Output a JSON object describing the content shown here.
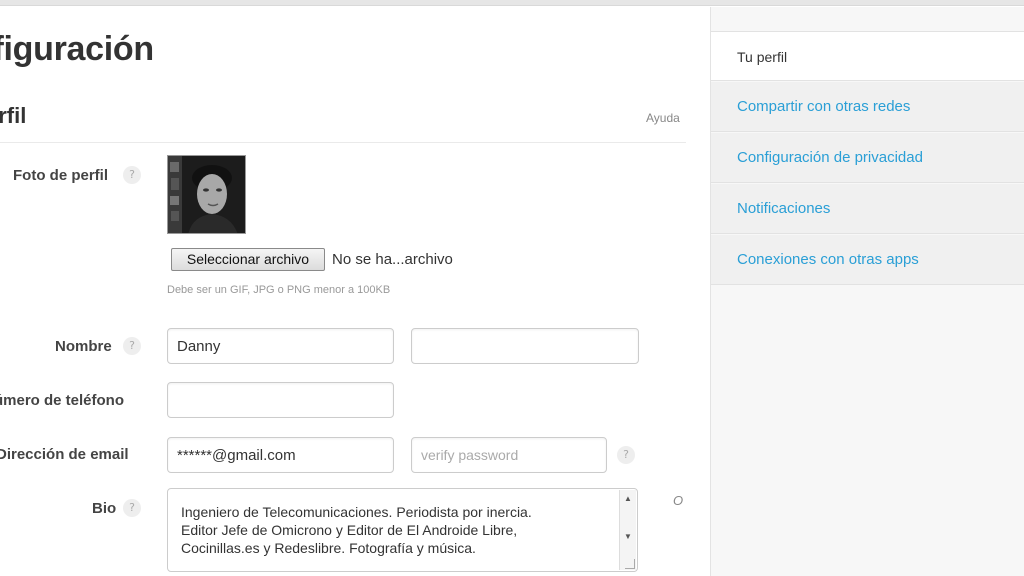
{
  "header": {
    "page_title": "nfiguración",
    "section_title": "erfil",
    "help_label": "Ayuda"
  },
  "profile_photo": {
    "label": "Foto de perfil",
    "file_button_label": "Seleccionar archivo",
    "file_status": "No se ha...archivo",
    "hint": "Debe ser un GIF, JPG o PNG menor a 100KB"
  },
  "name": {
    "label": "Nombre",
    "first_value": "Danny",
    "last_value": ""
  },
  "phone": {
    "label": "úmero de teléfono",
    "value": ""
  },
  "email": {
    "label": "Dirección de email",
    "value": "******@gmail.com",
    "verify_placeholder": "verify password"
  },
  "bio": {
    "label": "Bio",
    "lines": [
      "Ingeniero de Telecomunicaciones. Periodista por inercia.",
      "Editor Jefe de Omicrono y Editor de El Androide Libre,",
      "Cocinillas.es y Redeslibre. Fotografía y música."
    ],
    "side_mark": "O"
  },
  "help_glyph": "?",
  "sidebar": {
    "items": [
      {
        "label": "Tu perfil",
        "active": true
      },
      {
        "label": "Compartir con otras redes",
        "active": false
      },
      {
        "label": "Configuración de privacidad",
        "active": false
      },
      {
        "label": "Notificaciones",
        "active": false
      },
      {
        "label": "Conexiones con otras apps",
        "active": false
      }
    ]
  },
  "colors": {
    "link": "#2a9fd6",
    "sidebar_bg": "#f0f0f0",
    "text": "#333333"
  }
}
